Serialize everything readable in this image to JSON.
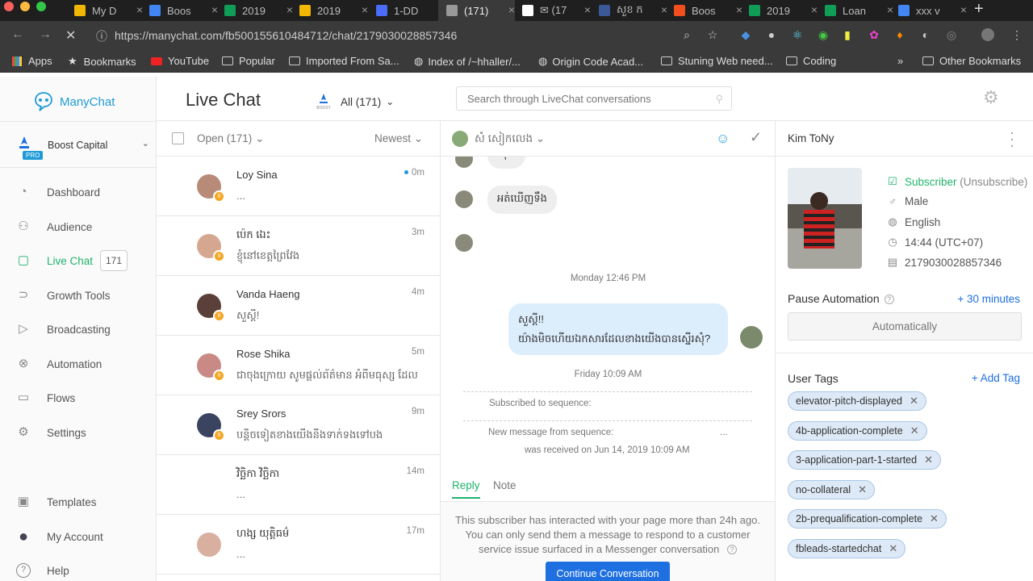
{
  "browser": {
    "tabs": [
      {
        "label": "My D",
        "color": "#f2b705"
      },
      {
        "label": "Boos",
        "color": "#4285f4"
      },
      {
        "label": "2019",
        "color": "#0f9d58"
      },
      {
        "label": "2019",
        "color": "#f2b705"
      },
      {
        "label": "1-DD",
        "color": "#4a6cf7"
      },
      {
        "label": "(171)",
        "color": "#999999"
      },
      {
        "label": "✉ (17",
        "color": "#ffffff"
      },
      {
        "label": "សួខ ក",
        "color": "#3b5998"
      },
      {
        "label": "Boos",
        "color": "#f24e1e"
      },
      {
        "label": "2019",
        "color": "#0f9d58"
      },
      {
        "label": "Loan",
        "color": "#0f9d58"
      },
      {
        "label": "xxx v",
        "color": "#4285f4"
      }
    ],
    "url": "https://manychat.com/fb500155610484712/chat/2179030028857346",
    "bookmarks": [
      "Apps",
      "Bookmarks",
      "YouTube",
      "Popular",
      "Imported From Sa...",
      "Index of /~hhaller/...",
      "Origin Code Acad...",
      "Stuning Web need...",
      "Coding"
    ],
    "other_bookmarks": "Other Bookmarks",
    "more": "»"
  },
  "sidebar": {
    "brand": "ManyChat",
    "page_name": "Boost Capital",
    "pro_badge": "PRO",
    "nav": [
      {
        "label": "Dashboard",
        "icon": "dashboard-icon"
      },
      {
        "label": "Audience",
        "icon": "person-icon"
      },
      {
        "label": "Live Chat",
        "icon": "chat-icon",
        "badge": "171"
      },
      {
        "label": "Growth Tools",
        "icon": "growth-icon"
      },
      {
        "label": "Broadcasting",
        "icon": "send-icon"
      },
      {
        "label": "Automation",
        "icon": "automation-icon"
      },
      {
        "label": "Flows",
        "icon": "folder-icon"
      },
      {
        "label": "Settings",
        "icon": "gear-icon"
      },
      {
        "label": "Templates",
        "icon": "template-icon"
      },
      {
        "label": "My Account",
        "icon": "avatar-icon"
      },
      {
        "label": "Help",
        "icon": "help-icon"
      }
    ]
  },
  "header": {
    "title": "Live Chat",
    "filter": "All (171)",
    "search_placeholder": "Search through LiveChat conversations"
  },
  "list": {
    "open_label": "Open (171)",
    "sort_label": "Newest",
    "conversations": [
      {
        "name": "Loy Sina",
        "message": "...",
        "time": "0m",
        "unread": true
      },
      {
        "name": "ប៉េក ឯេះ",
        "message": "ខ្ញុំនៅខេត្តព្រៃវែង",
        "time": "3m"
      },
      {
        "name": "Vanda Haeng",
        "message": "សួស្តី!",
        "time": "4m"
      },
      {
        "name": "Rose Shika",
        "message": "ជាចុងក្រោយ សូមផ្តល់ព័ត៌មាន អំពីមធុស្ស ដែល",
        "time": "5m"
      },
      {
        "name": "Srey Srors",
        "message": "បន្តិចទៀតខាងយើងនឹងទាក់ទងទៅបង",
        "time": "9m"
      },
      {
        "name": "វិច្ឆិកា វិច្ឆិកា",
        "message": "...",
        "time": "14m"
      },
      {
        "name": "ហង្ស យុត្តិធម៌",
        "message": "...",
        "time": "17m"
      }
    ]
  },
  "chat": {
    "contact": "សំ សៀកលេង",
    "messages_in": [
      "ស៊ុ...",
      "អត់ឃើញទឹង"
    ],
    "date1": "Monday 12:46 PM",
    "out_line1": "សួស្តី!!",
    "out_line2": "យ៉ាងមិចហើយឯកសារដែលខាងយើងបានស្នើរសុំ?",
    "date2": "Friday 10:09 AM",
    "sys1": "Subscribed to sequence:",
    "sys2": "New message from sequence:",
    "sys2_ellipsis": "...",
    "sys3": "was received on Jun 14, 2019 10:09 AM",
    "tab_reply": "Reply",
    "tab_note": "Note",
    "notice": "This subscriber has interacted with your page more than 24h ago. You can only send them a message to respond to a customer service issue surfaced in a Messenger conversation",
    "continue_btn": "Continue Conversation"
  },
  "profile": {
    "name": "Kim ToNy",
    "status": "Subscriber",
    "unsubscribe": "(Unsubscribe)",
    "gender": "Male",
    "language": "English",
    "time": "14:44 (UTC+07)",
    "id": "2179030028857346",
    "pause_label": "Pause Automation",
    "pause_add": "+ 30 minutes",
    "pause_value": "Automatically",
    "tags_label": "User Tags",
    "add_tag": "+ Add Tag",
    "tags": [
      "elevator-pitch-displayed",
      "4b-application-complete",
      "3-application-part-1-started",
      "no-collateral",
      "2b-prequalification-complete",
      "fbleads-startedchat"
    ]
  }
}
